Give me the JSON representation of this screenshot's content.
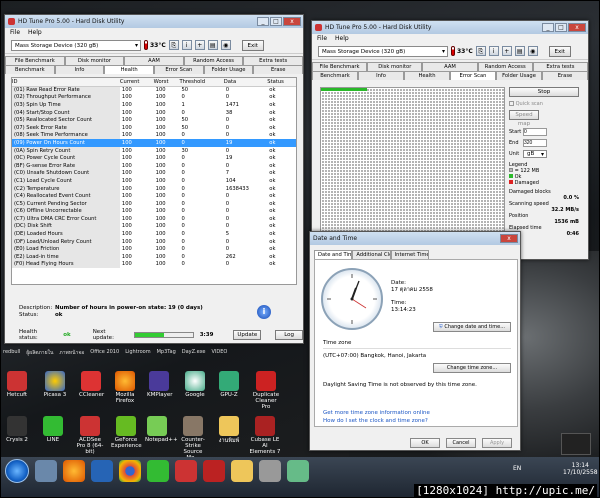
{
  "left_window": {
    "title": "HD Tune Pro 5.00 - Hard Disk Utility",
    "menu": [
      "File",
      "Help"
    ],
    "device": "Mass Storage Device  (320 gB)",
    "temperature": "33°C",
    "exit": "Exit",
    "tabs_row1": [
      "File Benchmark",
      "Disk monitor",
      "AAM",
      "Random Access",
      "Extra tests"
    ],
    "tabs_row2": [
      "Benchmark",
      "Info",
      "Health",
      "Error Scan",
      "Folder Usage",
      "Erase"
    ],
    "columns": [
      "ID",
      "Current",
      "Worst",
      "Threshold",
      "Data",
      "Status"
    ],
    "rows": [
      [
        "(01) Raw Read Error Rate",
        "100",
        "100",
        "50",
        "0",
        "ok"
      ],
      [
        "(02) Throughput Performance",
        "100",
        "100",
        "0",
        "0",
        "ok"
      ],
      [
        "(03) Spin Up Time",
        "100",
        "100",
        "1",
        "1471",
        "ok"
      ],
      [
        "(04) Start/Stop Count",
        "100",
        "100",
        "0",
        "38",
        "ok"
      ],
      [
        "(05) Reallocated Sector Count",
        "100",
        "100",
        "50",
        "0",
        "ok"
      ],
      [
        "(07) Seek Error Rate",
        "100",
        "100",
        "50",
        "0",
        "ok"
      ],
      [
        "(08) Seek Time Performance",
        "100",
        "100",
        "0",
        "0",
        "ok"
      ],
      [
        "(09) Power On Hours Count",
        "100",
        "100",
        "0",
        "19",
        "ok"
      ],
      [
        "(0A) Spin Retry Count",
        "100",
        "100",
        "30",
        "0",
        "ok"
      ],
      [
        "(0C) Power Cycle Count",
        "100",
        "100",
        "0",
        "19",
        "ok"
      ],
      [
        "(BF) G-sense Error Rate",
        "100",
        "100",
        "0",
        "0",
        "ok"
      ],
      [
        "(C0) Unsafe Shutdown Count",
        "100",
        "100",
        "0",
        "7",
        "ok"
      ],
      [
        "(C1) Load Cycle Count",
        "100",
        "100",
        "0",
        "104",
        "ok"
      ],
      [
        "(C2) Temperature",
        "100",
        "100",
        "0",
        "1638433",
        "ok"
      ],
      [
        "(C4) Reallocated Event Count",
        "100",
        "100",
        "0",
        "0",
        "ok"
      ],
      [
        "(C5) Current Pending Sector",
        "100",
        "100",
        "0",
        "0",
        "ok"
      ],
      [
        "(C6) Offline Uncorrectable",
        "100",
        "100",
        "0",
        "0",
        "ok"
      ],
      [
        "(C7) Ultra DMA CRC Error Count",
        "100",
        "100",
        "0",
        "0",
        "ok"
      ],
      [
        "(DC) Disk Shift",
        "100",
        "100",
        "0",
        "0",
        "ok"
      ],
      [
        "(DE) Loaded Hours",
        "100",
        "100",
        "0",
        "5",
        "ok"
      ],
      [
        "(DF) Load/Unload Retry Count",
        "100",
        "100",
        "0",
        "0",
        "ok"
      ],
      [
        "(E0) Load Friction",
        "100",
        "100",
        "0",
        "0",
        "ok"
      ],
      [
        "(E2) Load-in time",
        "100",
        "100",
        "0",
        "262",
        "ok"
      ],
      [
        "(F0) Head Flying Hours",
        "100",
        "100",
        "0",
        "0",
        "ok"
      ]
    ],
    "description_label": "Description:",
    "description": "Number of hours in power-on state: 19 (0 days)",
    "status_label": "Status:",
    "status": "ok",
    "health_label": "Health status:",
    "health": "ok",
    "next_update_label": "Next update:",
    "next_update": "3:39",
    "next_update_progress": 0.5,
    "update_btn": "Update",
    "log_btn": "Log"
  },
  "right_window": {
    "title": "HD Tune Pro 5.00 - Hard Disk Utility",
    "menu": [
      "File",
      "Help"
    ],
    "device": "Mass Storage Device  (320 gB)",
    "temperature": "33°C",
    "exit": "Exit",
    "tabs_row1": [
      "File Benchmark",
      "Disk monitor",
      "AAM",
      "Random Access",
      "Extra tests"
    ],
    "tabs_row2": [
      "Benchmark",
      "Info",
      "Health",
      "Error Scan",
      "Folder Usage",
      "Erase"
    ],
    "stop": "Stop",
    "quick_scan": "Quick scan",
    "speed_map": "Speed map",
    "start_label": "Start",
    "start_value": "0",
    "end_label": "End",
    "end_value": "320",
    "unit_label": "Unit",
    "unit_value": "gB",
    "legend_label": "Legend",
    "legend_size": "= 122 MB",
    "legend_ok": "Ok",
    "legend_damaged": "Damaged",
    "damaged_label": "Damaged blocks",
    "damaged_value": "0.0 %",
    "speed_label": "Scanning speed",
    "speed_value": "32.2 MB/s",
    "position_label": "Position",
    "position_value": "1536 mB",
    "elapsed_label": "Elapsed time",
    "elapsed_value": "0:46"
  },
  "datetime_window": {
    "title": "Date and Time",
    "tabs": [
      "Date and Time",
      "Additional Clocks",
      "Internet Time"
    ],
    "date_label": "Date:",
    "date": "17 ตุลาคม 2558",
    "time_label": "Time:",
    "time": "13:14:23",
    "change_dt": "Change date and time...",
    "tz_label": "Time zone",
    "tz": "(UTC+07:00) Bangkok, Hanoi, Jakarta",
    "change_tz": "Change time zone...",
    "dst": "Daylight Saving Time is not observed by this time zone.",
    "link1": "Get more time zone information online",
    "link2": "How do I set the clock and time zone?",
    "ok": "OK",
    "cancel": "Cancel",
    "apply": "Apply"
  },
  "desktop_top_labels": [
    "redbull",
    "ผู้ผลิตภายใน",
    "ภาพหน้าจอ",
    "Office 2010",
    "Lightroom",
    "Mp3Tag",
    "DayZ.exe",
    "VIDEO"
  ],
  "desktop_icons": [
    "Hetcuft",
    "Picasa 3",
    "CCleaner",
    "Mozilla Firefox",
    "KMPlayer",
    "Google",
    "GPU-Z",
    "Duplicate Cleaner Pro",
    "Crysis 2",
    "LINE",
    "ACDSee Pro 8 (64-bit)",
    "GeForce Experience",
    "Notepad++",
    "Counter-Strike Source Mo...",
    "งานพิมพ์",
    "Cubase LE AI Elements 7"
  ],
  "taskbar": {
    "lang": "EN",
    "time": "13:14",
    "date": "17/10/2558"
  },
  "watermark": "[1280x1024] http://upic.me/"
}
